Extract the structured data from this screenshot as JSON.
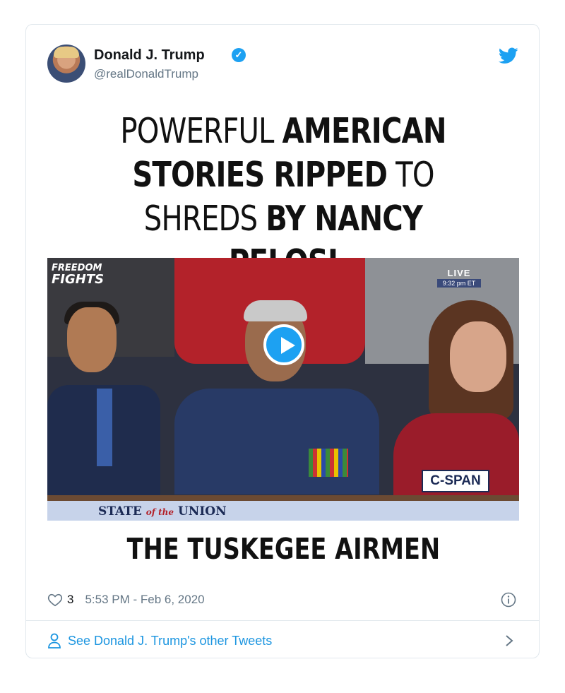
{
  "tweet": {
    "author_name": "Donald J. Trump",
    "handle": "@realDonaldTrump",
    "icons": {
      "avatar": "profile-photo",
      "verified": "verified-badge-icon",
      "brand": "twitter-bird-icon"
    },
    "media": {
      "headline": {
        "line1_a": "POWERFUL ",
        "line1_b": "AMERICAN",
        "line2_a": "STORIES RIPPED",
        "line2_b": " TO",
        "line3_a": "SHREDS ",
        "line3_b": "BY NANCY PELOSI"
      },
      "video": {
        "watermark_line1": "FREEDOM",
        "watermark_line2": "FIGHTS",
        "live_label": "LIVE",
        "live_time": "9:32 pm ET",
        "network": "C-SPAN",
        "banner_a": "STATE ",
        "banner_of": "of the",
        "banner_b": " UNION",
        "play_icon": "play-icon"
      },
      "caption": "THE TUSKEGEE AIRMEN"
    },
    "likes": "3",
    "timestamp": "5:53 PM - Feb 6, 2020",
    "see_more": "See Donald J. Trump's other Tweets"
  },
  "colors": {
    "accent": "#1da1f2",
    "link": "#1b95e0",
    "muted": "#657786",
    "border": "#e1e8ed"
  }
}
